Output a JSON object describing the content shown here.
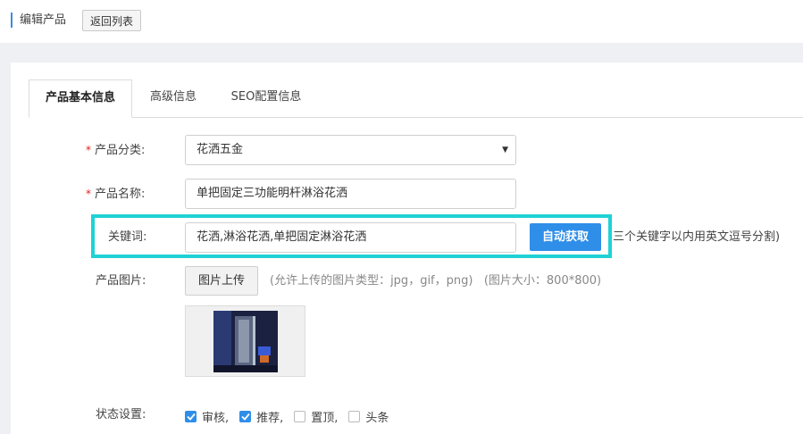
{
  "header": {
    "title": "编辑产品",
    "back_label": "返回列表"
  },
  "tabs": [
    {
      "label": "产品基本信息",
      "active": true
    },
    {
      "label": "高级信息",
      "active": false
    },
    {
      "label": "SEO配置信息",
      "active": false
    }
  ],
  "form": {
    "category": {
      "required_mark": "*",
      "label": "产品分类:",
      "selected": "花洒五金"
    },
    "name": {
      "required_mark": "*",
      "label": "产品名称:",
      "value": "单把固定三功能明杆淋浴花洒"
    },
    "keywords": {
      "label": "关键词:",
      "value": "花洒,淋浴花洒,单把固定淋浴花洒",
      "auto_button": "自动获取",
      "hint": "三个关键字以内用英文逗号分割)"
    },
    "image": {
      "label": "产品图片:",
      "upload_button": "图片上传",
      "hint": "(允许上传的图片类型：jpg，gif，png)   (图片大小：800*800)"
    },
    "status": {
      "label": "状态设置:",
      "options": [
        {
          "label": "审核,",
          "checked": true
        },
        {
          "label": "推荐,",
          "checked": true
        },
        {
          "label": "置顶,",
          "checked": false
        },
        {
          "label": "头条",
          "checked": false
        }
      ]
    }
  },
  "colors": {
    "accent": "#2f8ee8",
    "highlight": "#1fd2d5",
    "required": "#e02020"
  },
  "icons": {
    "select_arrow": "chevron-down-icon",
    "checkbox_checked": "check-icon"
  }
}
